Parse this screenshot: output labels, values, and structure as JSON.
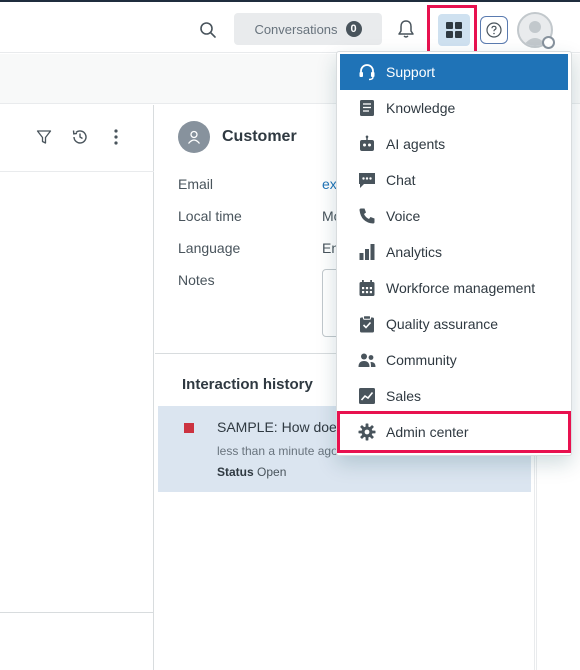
{
  "topbar": {
    "conversations_label": "Conversations",
    "conversations_count": "0"
  },
  "customer": {
    "title": "Customer",
    "fields": [
      {
        "label": "Email",
        "value": "ex"
      },
      {
        "label": "Local time",
        "value": "Mo"
      },
      {
        "label": "Language",
        "value": "En"
      },
      {
        "label": "Notes",
        "value": ""
      }
    ]
  },
  "history": {
    "title": "Interaction history",
    "subject": "SAMPLE: How does",
    "time": "less than a minute ago",
    "status_label": "Status",
    "status_value": "Open"
  },
  "menu": {
    "items": [
      {
        "label": "Support",
        "icon": "headset-icon"
      },
      {
        "label": "Knowledge",
        "icon": "book-icon"
      },
      {
        "label": "AI agents",
        "icon": "robot-icon"
      },
      {
        "label": "Chat",
        "icon": "chat-icon"
      },
      {
        "label": "Voice",
        "icon": "phone-icon"
      },
      {
        "label": "Analytics",
        "icon": "bar-chart-icon"
      },
      {
        "label": "Workforce management",
        "icon": "calendar-icon"
      },
      {
        "label": "Quality assurance",
        "icon": "clipboard-check-icon"
      },
      {
        "label": "Community",
        "icon": "people-icon"
      },
      {
        "label": "Sales",
        "icon": "trend-chart-icon"
      },
      {
        "label": "Admin center",
        "icon": "gear-icon"
      }
    ]
  },
  "colors": {
    "accent": "#1f73b7",
    "highlight": "#e8114f",
    "status_new": "#cc3340"
  }
}
